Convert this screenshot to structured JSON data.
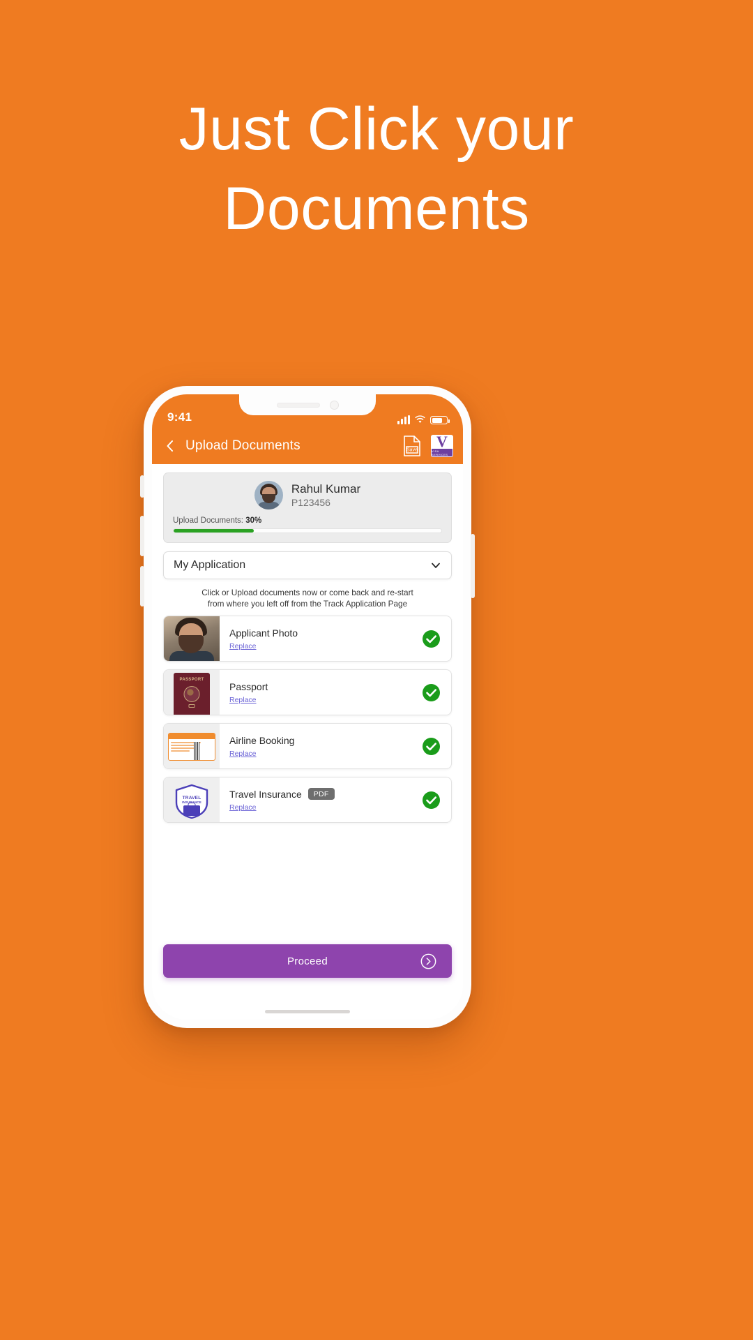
{
  "theme": {
    "background": "#ef7b21",
    "accent_purple": "#8e44ad",
    "success_green": "#2aa222",
    "link_color": "#6b63d6"
  },
  "headline": {
    "line1": "Just Click your",
    "line2": "Documents"
  },
  "phone": {
    "statusbar": {
      "time": "9:41",
      "signal_icon": "cellular-signal-icon",
      "wifi_icon": "wifi-icon",
      "battery_icon": "battery-icon"
    },
    "appbar": {
      "back_icon": "back-chevron-icon",
      "title": "Upload Documents",
      "save_icon_label": "Save",
      "brand_logo_letter": "V",
      "brand_logo_subtext": "VISA SERVICES"
    },
    "profile": {
      "avatar_icon": "user-avatar",
      "name": "Rahul Kumar",
      "id": "P123456",
      "progress_label": "Upload Documents:",
      "progress_value": "30%",
      "progress_percent": 30
    },
    "application_select": {
      "value": "My Application",
      "chevron_icon": "chevron-down-icon"
    },
    "instructions": {
      "line1": "Click or Upload documents now or come back and re-start",
      "line2": "from where you left off from the Track Application Page"
    },
    "documents": [
      {
        "title": "Applicant Photo",
        "replace_label": "Replace",
        "badge": "",
        "thumb_icon": "applicant-photo-thumbnail",
        "status_icon": "green-check-icon"
      },
      {
        "title": "Passport",
        "replace_label": "Replace",
        "badge": "",
        "thumb_icon": "passport-thumbnail",
        "thumb_text": "PASSPORT",
        "status_icon": "green-check-icon"
      },
      {
        "title": "Airline Booking",
        "replace_label": "Replace",
        "badge": "",
        "thumb_icon": "airline-ticket-thumbnail",
        "status_icon": "green-check-icon"
      },
      {
        "title": "Travel Insurance",
        "replace_label": "Replace",
        "badge": "PDF",
        "thumb_icon": "travel-insurance-shield-thumbnail",
        "thumb_text_1": "TRAVEL",
        "thumb_text_2": "INSURANCE",
        "status_icon": "green-check-icon"
      }
    ],
    "proceed": {
      "label": "Proceed",
      "arrow_icon": "circle-arrow-right-icon"
    }
  }
}
